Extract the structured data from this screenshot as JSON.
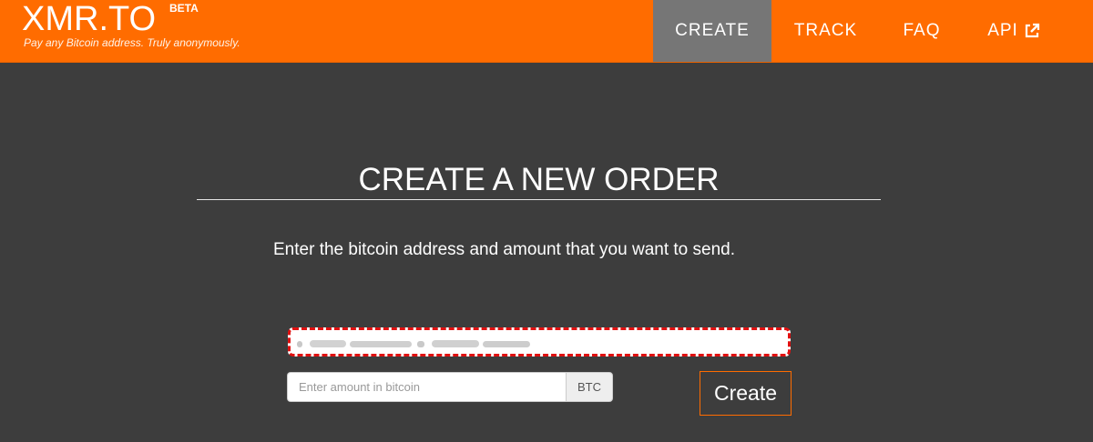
{
  "brand": {
    "name": "XMR.TO",
    "beta": "BETA",
    "tagline": "Pay any Bitcoin address. Truly anonymously."
  },
  "nav": {
    "items": [
      {
        "label": "CREATE",
        "active": true
      },
      {
        "label": "TRACK",
        "active": false
      },
      {
        "label": "FAQ",
        "active": false
      },
      {
        "label": "API",
        "active": false,
        "icon": "external-link-icon"
      }
    ]
  },
  "main": {
    "title": "CREATE A NEW ORDER",
    "instructions": "Enter the bitcoin address and amount that you want to send.",
    "address_input": {
      "value": "",
      "state": "focused-invalid",
      "obscured": true
    },
    "amount_input": {
      "placeholder": "Enter amount in bitcoin",
      "value": ""
    },
    "amount_unit": "BTC",
    "create_label": "Create"
  },
  "colors": {
    "brand_orange": "#ff6c00",
    "nav_active": "#767676",
    "background": "#3d3d3d",
    "invalid_border": "#e01010"
  }
}
